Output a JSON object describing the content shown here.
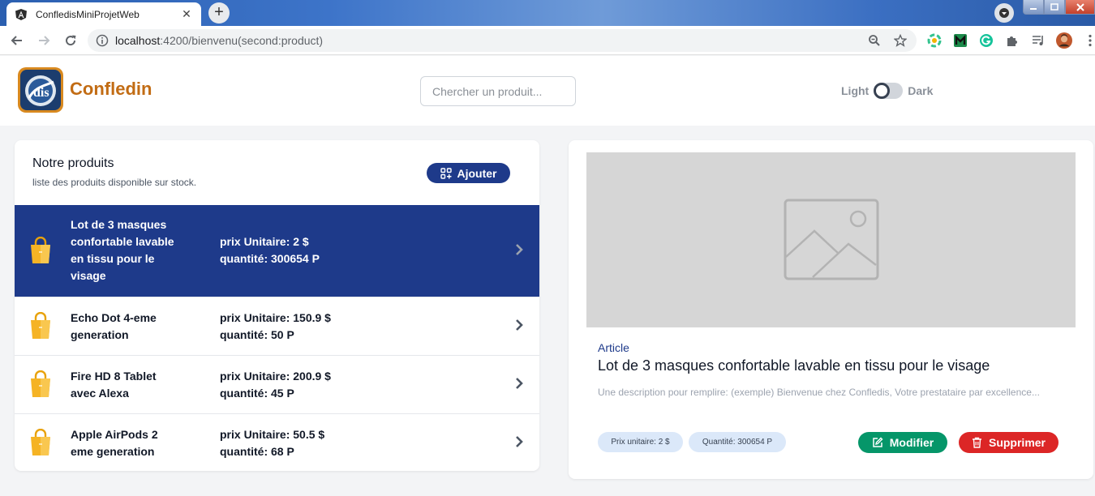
{
  "browser": {
    "tab_title": "ConfledisMiniProjetWeb",
    "tab_close": "✕",
    "new_tab": "+",
    "url_host": "localhost",
    "url_rest": ":4200/bienvenu(second:product)"
  },
  "header": {
    "brand": "Confledin",
    "search_placeholder": "Chercher un produit...",
    "theme_light": "Light",
    "theme_dark": "Dark",
    "dark_mode": false
  },
  "list": {
    "title": "Notre produits",
    "subtitle": "liste des produits disponible sur stock.",
    "add_label": "Ajouter",
    "items": [
      {
        "name": "Lot de 3 masques confortable lavable en tissu pour le visage",
        "price": "prix Unitaire: 2 $",
        "qty": "quantité: 300654 P",
        "selected": true
      },
      {
        "name": "Echo Dot 4-eme generation",
        "price": "prix Unitaire: 150.9 $",
        "qty": "quantité: 50 P",
        "selected": false
      },
      {
        "name": "Fire HD 8 Tablet avec Alexa",
        "price": "prix Unitaire: 200.9 $",
        "qty": "quantité: 45 P",
        "selected": false
      },
      {
        "name": "Apple AirPods 2 eme generation",
        "price": "prix Unitaire: 50.5 $",
        "qty": "quantité: 68 P",
        "selected": false
      }
    ]
  },
  "detail": {
    "kind": "Article",
    "title": "Lot de 3 masques confortable lavable en tissu pour le visage",
    "description": "Une description pour remplire: (exemple) Bienvenue chez Confledis, Votre prestataire par excellence...",
    "chip_price": "Prix unitaire: 2 $",
    "chip_qty": "Quantité: 300654 P",
    "edit_label": "Modifier",
    "delete_label": "Supprimer"
  },
  "colors": {
    "primary": "#1e3a8a",
    "brand": "#c26c14",
    "edit": "#059669",
    "delete": "#dc2626"
  }
}
